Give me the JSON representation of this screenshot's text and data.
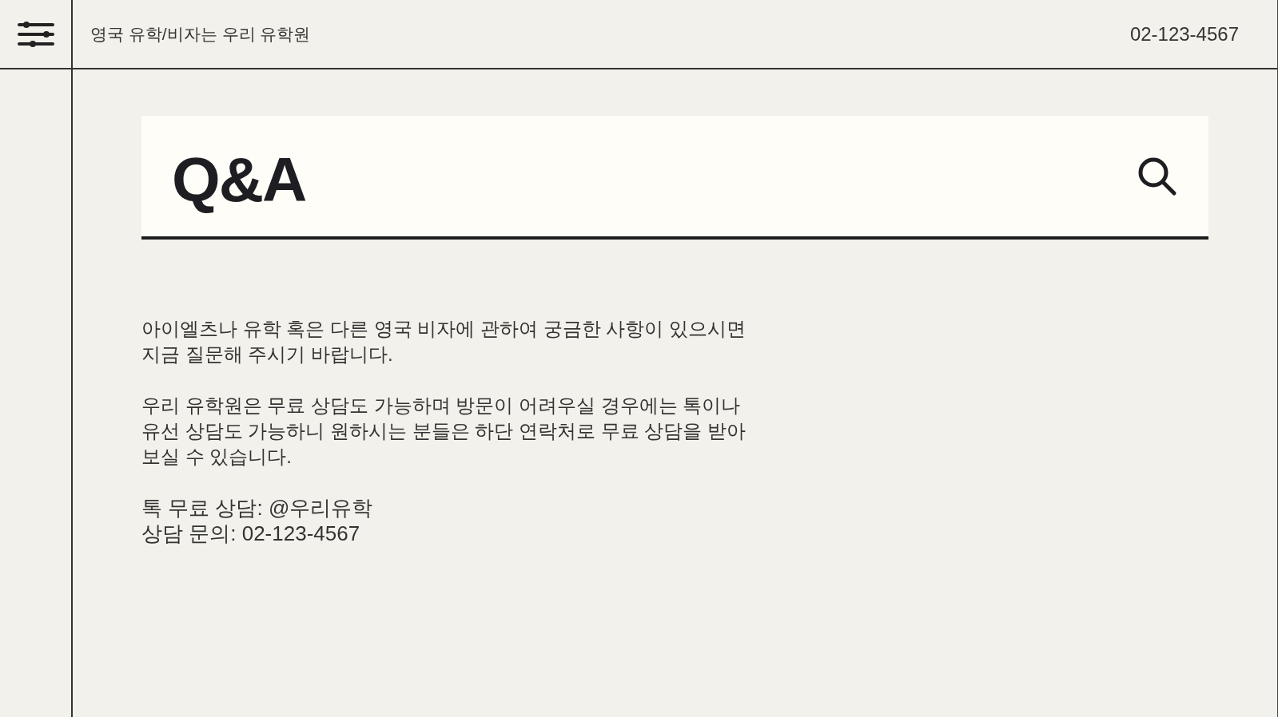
{
  "header": {
    "title": "영국 유학/비자는 우리 유학원",
    "phone": "02-123-4567"
  },
  "search_banner": {
    "title": "Q&A"
  },
  "paragraphs": [
    [
      "아이엘츠나 유학 혹은 다른 영국 비자에 관하여 궁금한 사항이 있으시면",
      "지금 질문해 주시기 바랍니다."
    ],
    [
      "우리 유학원은 무료 상담도 가능하며 방문이 어려우실 경우에는 톡이나",
      "유선 상담도 가능하니 원하시는 분들은 하단 연락처로 무료 상담을 받아",
      "보실 수 있습니다."
    ],
    [
      "톡 무료 상담: @우리유학",
      "상담 문의: 02-123-4567"
    ]
  ]
}
